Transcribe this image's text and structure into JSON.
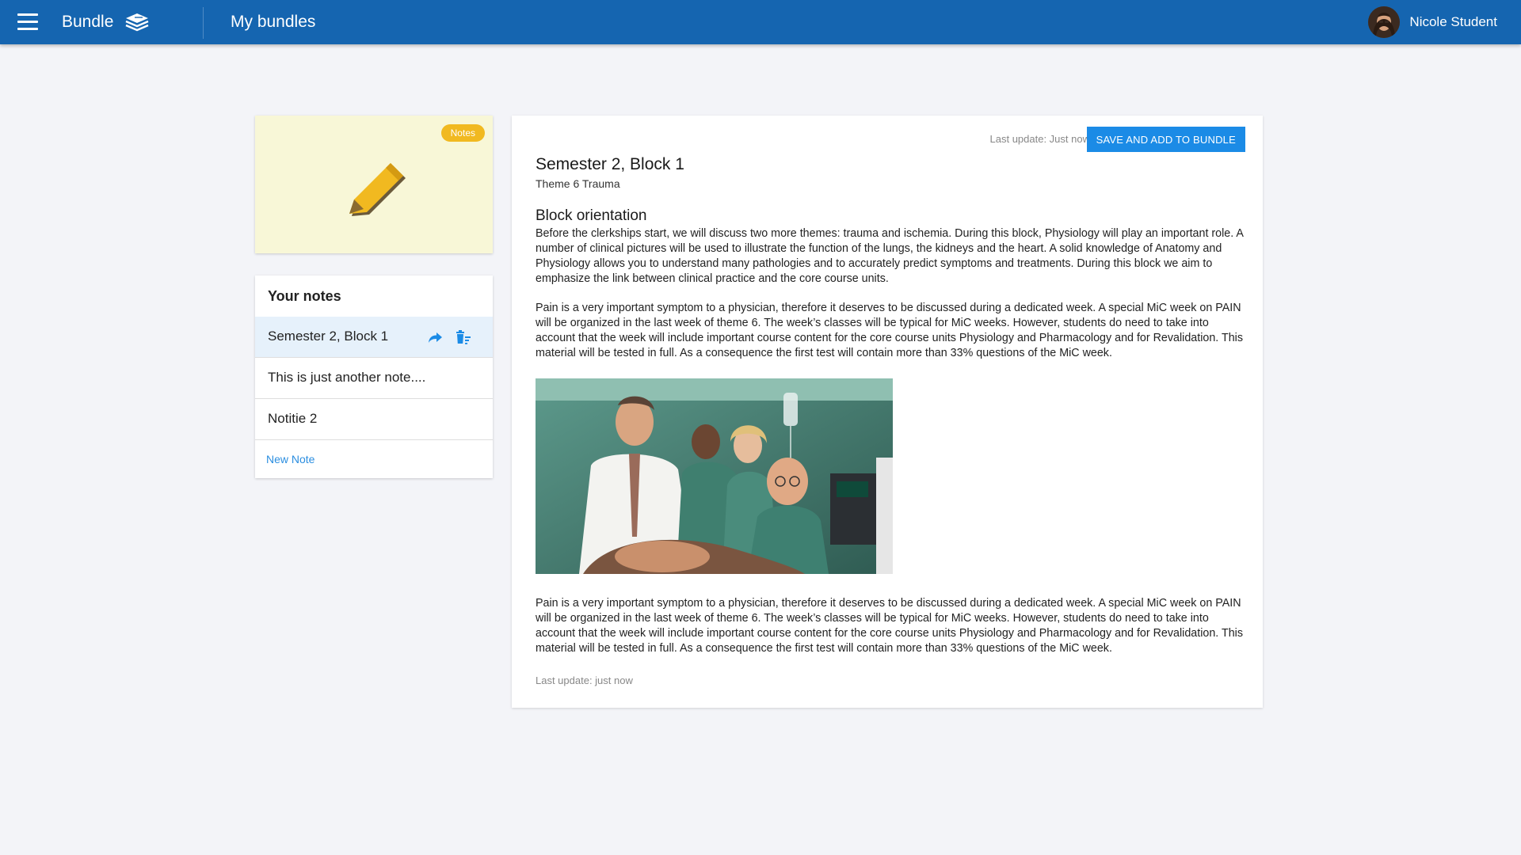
{
  "header": {
    "brand": "Bundle",
    "page_title": "My bundles",
    "user_name": "Nicole Student",
    "brand_color": "#1565b0"
  },
  "hero": {
    "badge": "Notes",
    "icon": "pencil-icon",
    "background": "#f8f7d7"
  },
  "notes_panel": {
    "heading": "Your notes",
    "items": [
      {
        "label": "Semester 2, Block 1",
        "active": true
      },
      {
        "label": "This is just another note...."
      },
      {
        "label": "Notitie 2"
      }
    ],
    "new_note": "New Note"
  },
  "document": {
    "last_update_top": "Last update: Just now",
    "save_button": "SAVE AND ADD TO BUNDLE",
    "title": "Semester 2, Block 1",
    "subtitle": "Theme 6 Trauma",
    "section_title": "Block orientation",
    "paragraph_1": "Before the clerkships start, we will discuss two more themes: trauma and ischemia. During this block, Physiology will play an important role. A number of clinical pictures will be used to illustrate the function of the lungs, the kidneys and the heart. A solid knowledge of Anatomy and Physiology allows you to understand many pathologies and to accurately predict symptoms and treatments. During this block we aim to emphasize the link between clinical practice and the core course units.",
    "paragraph_2": "Pain is a very important symptom to a physician, therefore it deserves to be discussed during a dedicated week. A special MiC week on PAIN will be organized in the last week of theme 6. The week’s classes will be typical for MiC weeks. However, students do need to take into account that the week will include important course content for the core course units Physiology and Pharmacology and for Revalidation. This material will be tested in full. As a consequence the first test will contain more than 33% questions of the MiC week.",
    "paragraph_3": "Pain is a very important symptom to a physician, therefore it deserves to be discussed during a dedicated week. A special MiC week on PAIN will be organized in the last week of theme 6. The week’s classes will be typical for MiC weeks. However, students do need to take into account that the week will include important course content for the core course units Physiology and Pharmacology and for Revalidation. This material will be tested in full. As a consequence the first test will contain more than 33% questions of the MiC week.",
    "last_update_bottom": "Last update: just now",
    "accent_color": "#1b8be6"
  }
}
